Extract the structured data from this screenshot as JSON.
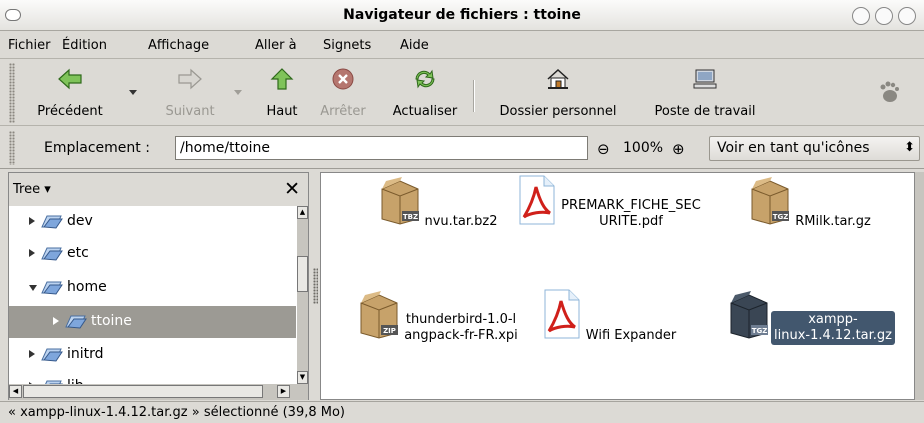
{
  "window": {
    "title": "Navigateur de fichiers : ttoine"
  },
  "menubar": {
    "items": [
      {
        "label": "Fichier"
      },
      {
        "label": "Édition"
      },
      {
        "label": "Affichage"
      },
      {
        "label": "Aller à"
      },
      {
        "label": "Signets"
      },
      {
        "label": "Aide"
      }
    ]
  },
  "toolbar": {
    "back": "Précédent",
    "forward": "Suivant",
    "up": "Haut",
    "stop": "Arrêter",
    "reload": "Actualiser",
    "home": "Dossier personnel",
    "computer": "Poste de travail"
  },
  "location": {
    "label": "Emplacement :",
    "path": "/home/ttoine",
    "zoom": "100%",
    "view_mode": "Voir en tant qu'icônes"
  },
  "sidebar": {
    "title": "Tree",
    "nodes": [
      {
        "name": "dev",
        "expanded": false,
        "selected": false
      },
      {
        "name": "etc",
        "expanded": false,
        "selected": false
      },
      {
        "name": "home",
        "expanded": true,
        "selected": false
      },
      {
        "name": "ttoine",
        "expanded": false,
        "selected": true
      },
      {
        "name": "initrd",
        "expanded": false,
        "selected": false
      },
      {
        "name": "lib",
        "expanded": false,
        "selected": false
      }
    ]
  },
  "files": [
    {
      "name": "nvu.tar.bz2",
      "badge": "TBZ",
      "kind": "archive",
      "selected": false
    },
    {
      "name": "PREMARK_FICHE_SECURITE.pdf",
      "badge": "",
      "kind": "pdf",
      "selected": false
    },
    {
      "name": "RMilk.tar.gz",
      "badge": "TGZ",
      "kind": "archive",
      "selected": false
    },
    {
      "name": "thunderbird-1.0-langpack-fr-FR.xpi",
      "badge": "ZIP",
      "kind": "archive",
      "selected": false
    },
    {
      "name": "Wifi Expander",
      "badge": "",
      "kind": "pdf",
      "selected": false
    },
    {
      "name": "xampp-linux-1.4.12.tar.gz",
      "badge": "TGZ",
      "kind": "archive",
      "selected": true
    }
  ],
  "status": {
    "text": "« xampp-linux-1.4.12.tar.gz » sélectionné (39,8 Mo)"
  },
  "colors": {
    "selection": "#42576e",
    "tree_selection": "#9c9a94",
    "window_bg": "#dcdad5"
  }
}
